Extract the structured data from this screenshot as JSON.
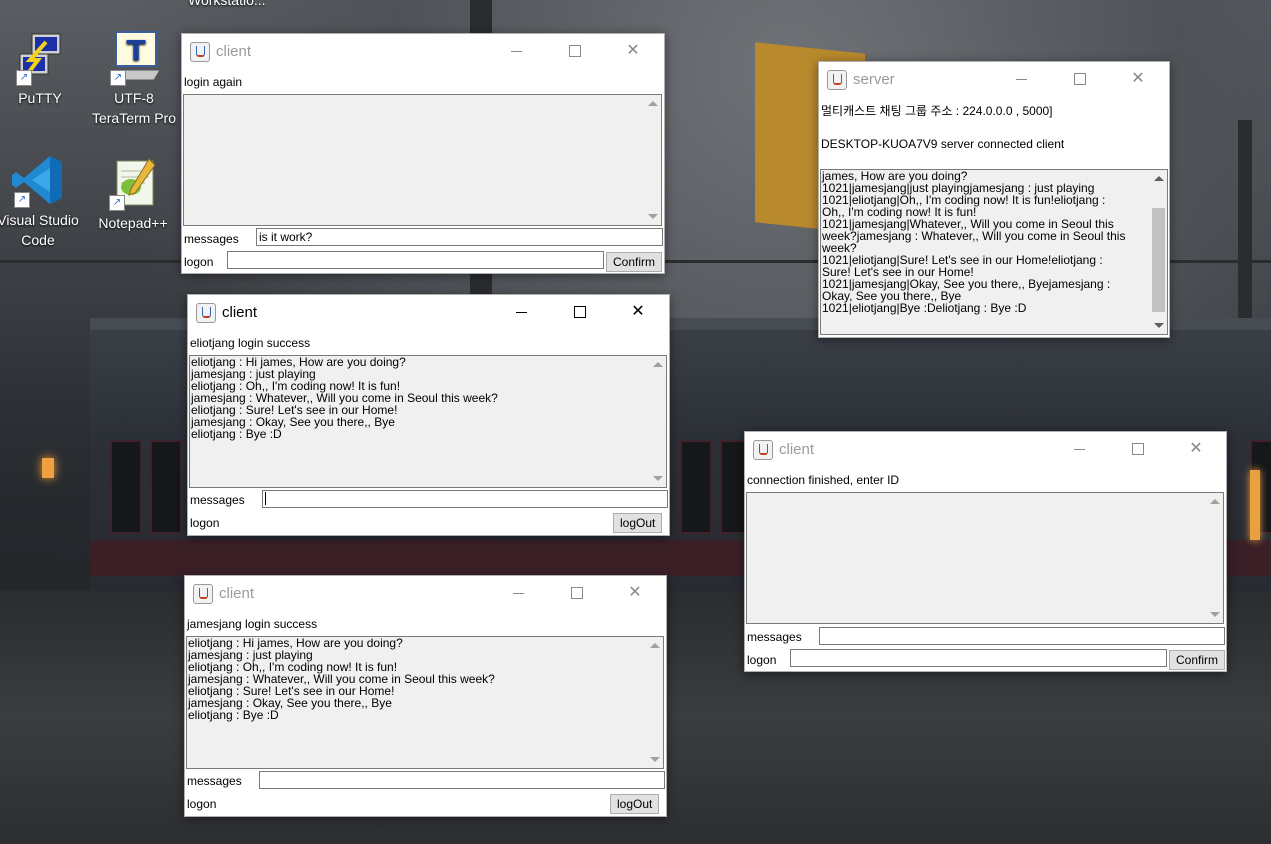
{
  "desktop": {
    "top_label": "Workstatio...",
    "icons": [
      {
        "label": "PuTTY"
      },
      {
        "label": "UTF-8 TeraTerm Pro"
      },
      {
        "label": "Visual Studio Code"
      },
      {
        "label": "Notepad++"
      }
    ]
  },
  "client1": {
    "title": "client",
    "status": "login again",
    "log": [],
    "messages_label": "messages",
    "messages_value": "is it work?",
    "logon_label": "logon",
    "logon_value": "",
    "button": "Confirm"
  },
  "client2": {
    "title": "client",
    "status": "eliotjang login success",
    "log": [
      "eliotjang : Hi james, How are you doing?",
      "jamesjang : just playing",
      "eliotjang : Oh,, I'm coding now! It is fun!",
      "jamesjang : Whatever,, Will you come in Seoul this week?",
      "eliotjang : Sure! Let's see in our Home!",
      "jamesjang : Okay, See you there,, Bye",
      "eliotjang : Bye :D"
    ],
    "messages_label": "messages",
    "messages_value": "",
    "logon_label": "logon",
    "button": "logOut"
  },
  "client3": {
    "title": "client",
    "status": "jamesjang login success",
    "log": [
      "eliotjang : Hi james, How are you doing?",
      "jamesjang : just playing",
      "eliotjang : Oh,, I'm coding now! It is fun!",
      "jamesjang : Whatever,, Will you come in Seoul this week?",
      "eliotjang : Sure! Let's see in our Home!",
      "jamesjang : Okay, See you there,, Bye",
      "eliotjang : Bye :D"
    ],
    "messages_label": "messages",
    "messages_value": "",
    "logon_label": "logon",
    "button": "logOut"
  },
  "client4": {
    "title": "client",
    "status": "connection finished, enter ID",
    "log": [],
    "messages_label": "messages",
    "messages_value": "",
    "logon_label": "logon",
    "logon_value": "",
    "button": "Confirm"
  },
  "server": {
    "title": "server",
    "group_info": "멀티캐스트 채팅 그룹 주소 : 224.0.0.0 , 5000]",
    "connected": "DESKTOP-KUOA7V9 server connected client",
    "log": [
      "james, How are you doing?",
      "1021|jamesjang|just playingjamesjang : just playing",
      "1021|eliotjang|Oh,, I'm coding now! It is fun!eliotjang :",
      "Oh,, I'm coding now! It is fun!",
      "1021|jamesjang|Whatever,, Will you come in Seoul this",
      "week?jamesjang : Whatever,, Will you come in Seoul this",
      "week?",
      "1021|eliotjang|Sure! Let's see in our Home!eliotjang :",
      "Sure! Let's see in our Home!",
      "1021|jamesjang|Okay, See you there,, Byejamesjang :",
      "Okay, See you there,, Bye",
      "1021|eliotjang|Bye :Deliotjang : Bye :D"
    ]
  }
}
